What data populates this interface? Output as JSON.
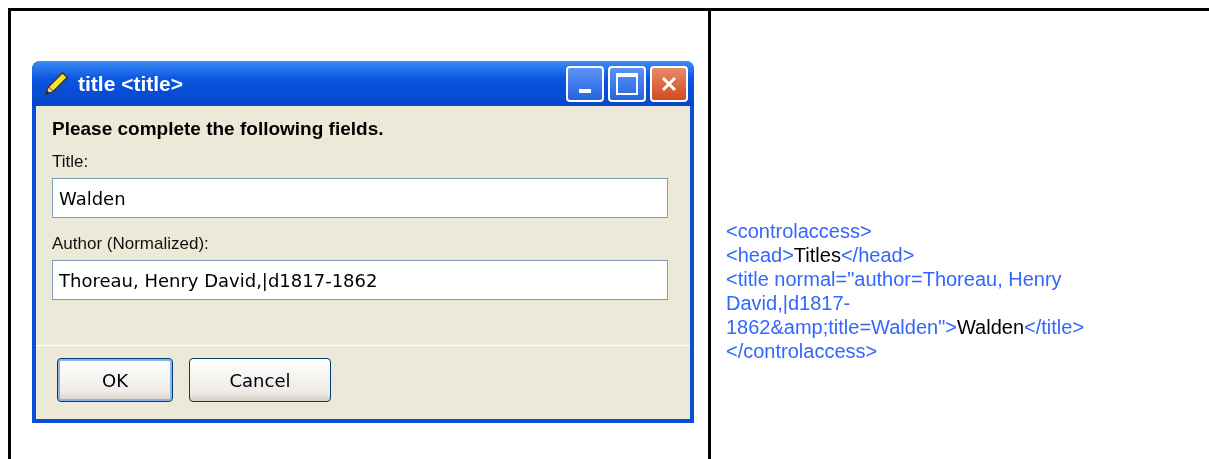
{
  "dialog": {
    "title": "title <title>",
    "instruction": "Please complete the following fields.",
    "fields": [
      {
        "label": "Title:",
        "value": "Walden"
      },
      {
        "label": "Author (Normalized):",
        "value": "Thoreau, Henry David,|d1817-1862"
      }
    ],
    "buttons": [
      {
        "label": "OK",
        "default": true
      },
      {
        "label": "Cancel",
        "default": false
      }
    ]
  },
  "code": {
    "lines": [
      [
        {
          "kind": "markup",
          "text": "<controlaccess>"
        }
      ],
      [
        {
          "kind": "markup",
          "text": "<head>"
        },
        {
          "kind": "content",
          "text": "Titles"
        },
        {
          "kind": "markup",
          "text": "</head>"
        }
      ],
      [
        {
          "kind": "markup",
          "text": "<title normal=\"author=Thoreau, Henry"
        }
      ],
      [
        {
          "kind": "markup",
          "text": "David,|d1817-"
        }
      ],
      [
        {
          "kind": "markup",
          "text": "1862&amp;title=Walden\">"
        },
        {
          "kind": "content",
          "text": "Walden"
        },
        {
          "kind": "markup",
          "text": "</title>"
        }
      ],
      [
        {
          "kind": "markup",
          "text": "</controlaccess>"
        }
      ]
    ]
  }
}
